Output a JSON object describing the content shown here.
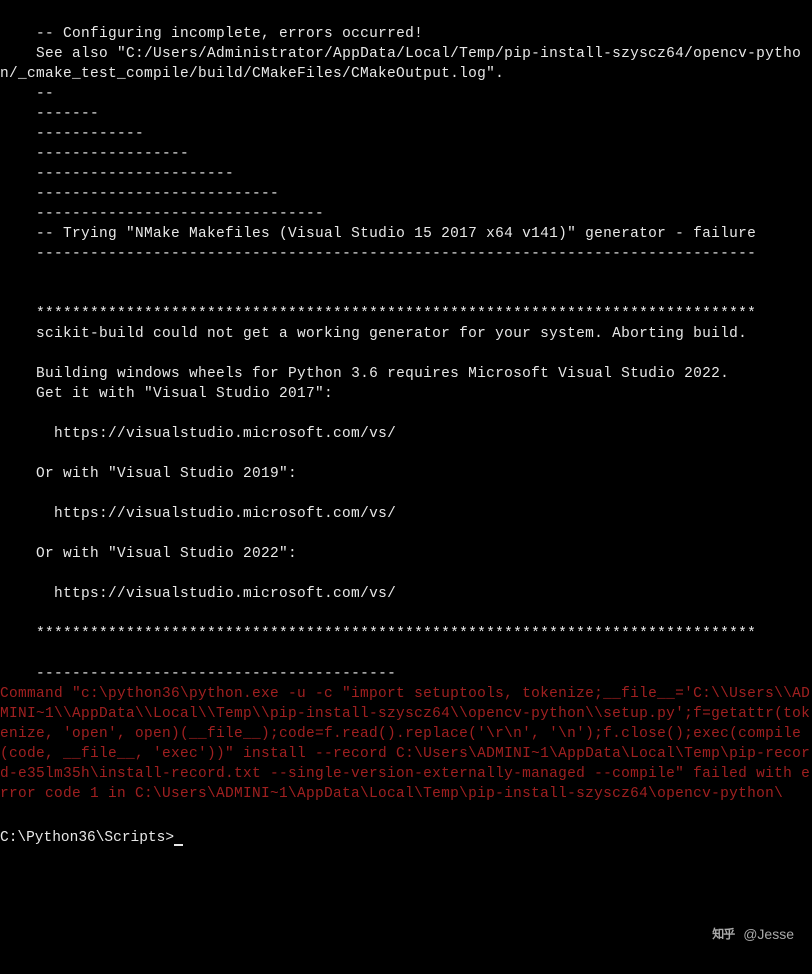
{
  "lines": [
    {
      "cls": "white-text",
      "text": "    -- Configuring incomplete, errors occurred!"
    },
    {
      "cls": "white-text",
      "text": "    See also \"C:/Users/Administrator/AppData/Local/Temp/pip-install-szyscz64/opencv-python/_cmake_test_compile/build/CMakeFiles/CMakeOutput.log\"."
    },
    {
      "cls": "white-text",
      "text": "    --"
    },
    {
      "cls": "white-text",
      "text": "    -------"
    },
    {
      "cls": "white-text",
      "text": "    ------------"
    },
    {
      "cls": "white-text",
      "text": "    -----------------"
    },
    {
      "cls": "white-text",
      "text": "    ----------------------"
    },
    {
      "cls": "white-text",
      "text": "    ---------------------------"
    },
    {
      "cls": "white-text",
      "text": "    --------------------------------"
    },
    {
      "cls": "white-text",
      "text": "    -- Trying \"NMake Makefiles (Visual Studio 15 2017 x64 v141)\" generator - failure"
    },
    {
      "cls": "white-text",
      "text": "    --------------------------------------------------------------------------------"
    },
    {
      "cls": "white-text",
      "text": ""
    },
    {
      "cls": "white-text",
      "text": ""
    },
    {
      "cls": "white-text",
      "text": "    ********************************************************************************"
    },
    {
      "cls": "white-text",
      "text": "    scikit-build could not get a working generator for your system. Aborting build."
    },
    {
      "cls": "white-text",
      "text": ""
    },
    {
      "cls": "white-text",
      "text": "    Building windows wheels for Python 3.6 requires Microsoft Visual Studio 2022."
    },
    {
      "cls": "white-text",
      "text": "    Get it with \"Visual Studio 2017\":"
    },
    {
      "cls": "white-text",
      "text": ""
    },
    {
      "cls": "white-text",
      "text": "      https://visualstudio.microsoft.com/vs/"
    },
    {
      "cls": "white-text",
      "text": ""
    },
    {
      "cls": "white-text",
      "text": "    Or with \"Visual Studio 2019\":"
    },
    {
      "cls": "white-text",
      "text": ""
    },
    {
      "cls": "white-text",
      "text": "      https://visualstudio.microsoft.com/vs/"
    },
    {
      "cls": "white-text",
      "text": ""
    },
    {
      "cls": "white-text",
      "text": "    Or with \"Visual Studio 2022\":"
    },
    {
      "cls": "white-text",
      "text": ""
    },
    {
      "cls": "white-text",
      "text": "      https://visualstudio.microsoft.com/vs/"
    },
    {
      "cls": "white-text",
      "text": ""
    },
    {
      "cls": "white-text",
      "text": "    ********************************************************************************"
    },
    {
      "cls": "white-text",
      "text": ""
    },
    {
      "cls": "white-text",
      "text": "    ----------------------------------------"
    },
    {
      "cls": "red-text",
      "text": "Command \"c:\\python36\\python.exe -u -c \"import setuptools, tokenize;__file__='C:\\\\Users\\\\ADMINI~1\\\\AppData\\\\Local\\\\Temp\\\\pip-install-szyscz64\\\\opencv-python\\\\setup.py';f=getattr(tokenize, 'open', open)(__file__);code=f.read().replace('\\r\\n', '\\n');f.close();exec(compile(code, __file__, 'exec'))\" install --record C:\\Users\\ADMINI~1\\AppData\\Local\\Temp\\pip-record-e35lm35h\\install-record.txt --single-version-externally-managed --compile\" failed with error code 1 in C:\\Users\\ADMINI~1\\AppData\\Local\\Temp\\pip-install-szyscz64\\opencv-python\\"
    }
  ],
  "prompt": "C:\\Python36\\Scripts>",
  "watermark": {
    "platform": "知乎",
    "handle": "@Jesse"
  }
}
